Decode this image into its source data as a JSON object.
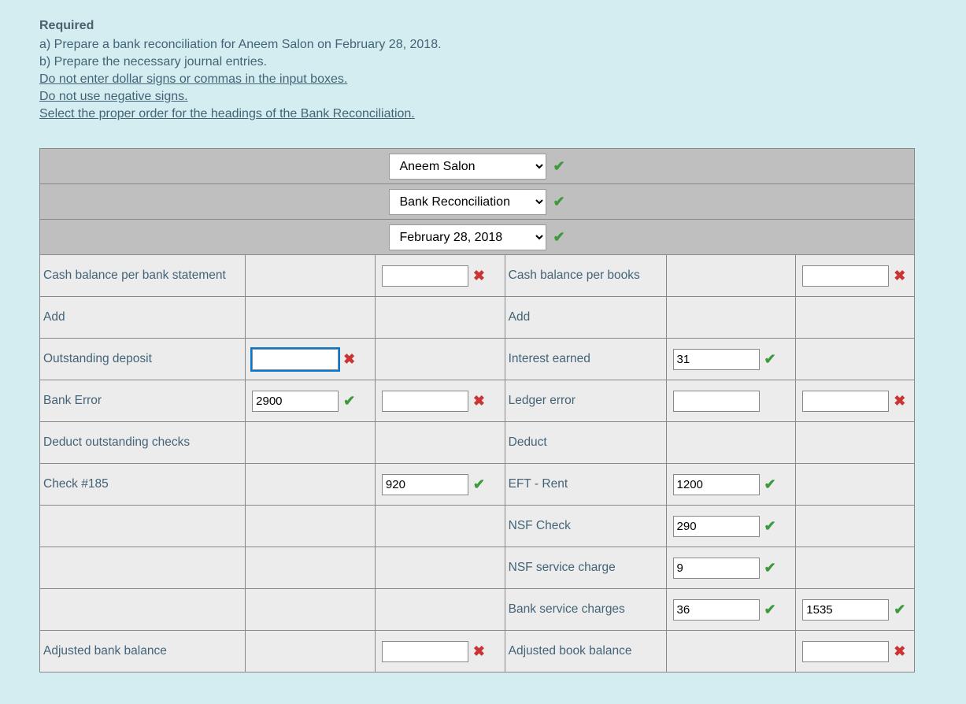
{
  "required": {
    "title": "Required",
    "line_a": "a) Prepare a bank reconciliation for Aneem Salon on February 28, 2018.",
    "line_b": "b) Prepare the necessary journal entries.",
    "rule1": "Do not enter dollar signs or commas in the input boxes.",
    "rule2": "Do not use negative signs.",
    "rule3": "Select the proper order for the headings of the Bank Reconciliation."
  },
  "header": {
    "row1": "Aneem Salon",
    "row2": "Bank Reconciliation",
    "row3": "February 28, 2018"
  },
  "bank": {
    "cash_balance_label": "Cash balance per bank statement",
    "cash_balance_value": "",
    "add_label": "Add",
    "outstanding_deposit_label": "Outstanding deposit",
    "outstanding_deposit_value": "",
    "bank_error_label": "Bank Error",
    "bank_error_value": "2900",
    "bank_error_total": "",
    "deduct_label": "Deduct outstanding checks",
    "check185_label": "Check #185",
    "check185_value": "920",
    "adjusted_label": "Adjusted bank balance",
    "adjusted_value": ""
  },
  "books": {
    "cash_balance_label": "Cash balance per books",
    "cash_balance_value": "",
    "add_label": "Add",
    "interest_label": "Interest earned",
    "interest_value": "31",
    "ledger_error_label": "Ledger error",
    "ledger_error_value": "",
    "ledger_error_total": "",
    "deduct_label": "Deduct",
    "eft_label": "EFT - Rent",
    "eft_value": "1200",
    "nsf_check_label": "NSF Check",
    "nsf_check_value": "290",
    "nsf_service_label": "NSF service charge",
    "nsf_service_value": "9",
    "bank_service_label": "Bank service charges",
    "bank_service_value": "36",
    "deduct_total": "1535",
    "adjusted_label": "Adjusted book balance",
    "adjusted_value": ""
  },
  "marks": {
    "correct": "✔",
    "wrong": "✖"
  }
}
